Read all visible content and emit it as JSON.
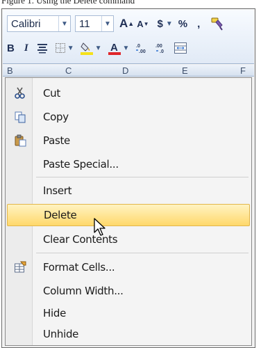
{
  "caption": "Figure 1. Using the Delete command",
  "toolbar": {
    "font_name": "Calibri",
    "font_size": "11",
    "grow_font": "A",
    "shrink_font": "A",
    "currency": "$",
    "percent": "%",
    "comma": ",",
    "bold": "B",
    "italic": "I"
  },
  "columns": [
    "B",
    "C",
    "D",
    "E",
    "F"
  ],
  "menu": {
    "items": [
      {
        "label": "Cut",
        "icon": "scissors-icon"
      },
      {
        "label": "Copy",
        "icon": "copy-icon"
      },
      {
        "label": "Paste",
        "icon": "paste-icon"
      },
      {
        "label": "Paste Special...",
        "icon": ""
      },
      {
        "label": "Insert",
        "icon": ""
      },
      {
        "label": "Delete",
        "icon": "",
        "highlighted": true
      },
      {
        "label": "Clear Contents",
        "icon": ""
      },
      {
        "label": "Format Cells...",
        "icon": "format-cells-icon"
      },
      {
        "label": "Column Width...",
        "icon": ""
      },
      {
        "label": "Hide",
        "icon": ""
      },
      {
        "label": "Unhide",
        "icon": ""
      }
    ]
  },
  "colors": {
    "highlight_top": "#fff3c2",
    "highlight_bottom": "#ffd86b",
    "fill_color_bar": "#f5e11a",
    "font_color_bar": "#e0262a"
  }
}
